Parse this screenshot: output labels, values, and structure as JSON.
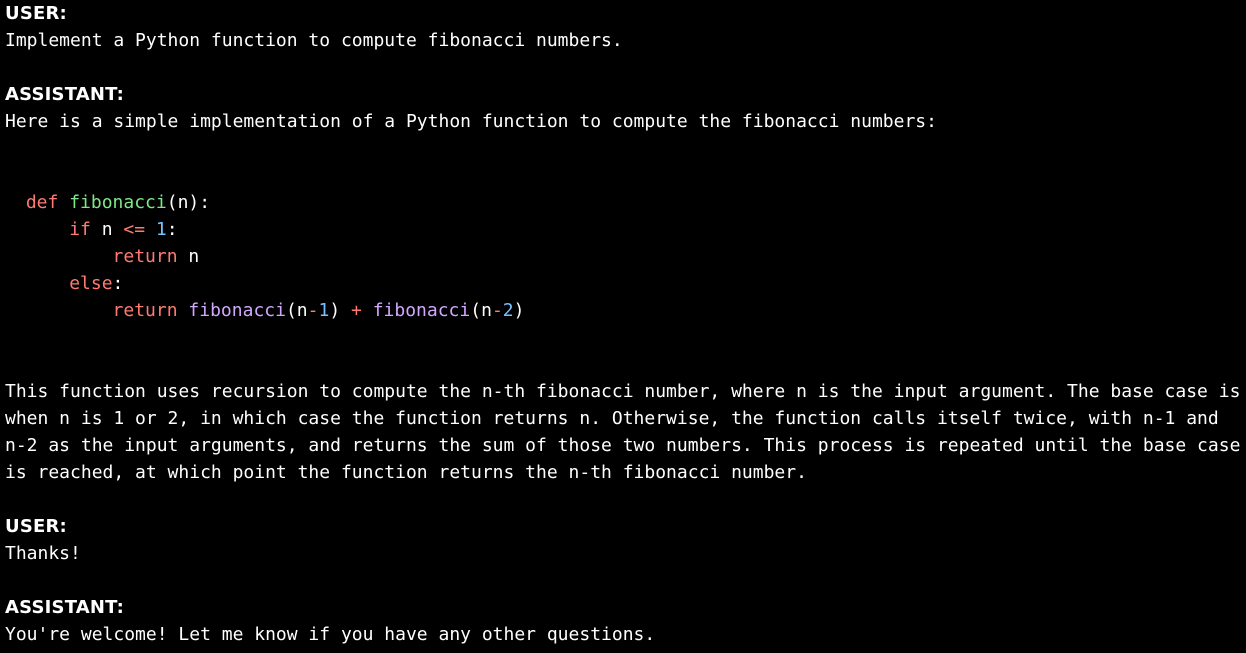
{
  "turns": {
    "t1": {
      "speaker": "USER:",
      "text": "Implement a Python function to compute fibonacci numbers."
    },
    "t2": {
      "speaker": "ASSISTANT:",
      "text": "Here is a simple implementation of a Python function to compute the fibonacci numbers:"
    },
    "t3": {
      "text": "This function uses recursion to compute the n-th fibonacci number, where n is the input argument. The base case is when n is 1 or 2, in which case the function returns n. Otherwise, the function calls itself twice, with n-1 and n-2 as the input arguments, and returns the sum of those two numbers. This process is repeated until the base case is reached, at which point the function returns the n-th fibonacci number."
    },
    "t4": {
      "speaker": "USER:",
      "text": "Thanks!"
    },
    "t5": {
      "speaker": "ASSISTANT:",
      "text": "You're welcome! Let me know if you have any other questions."
    }
  },
  "code": {
    "l1": {
      "kw": "def",
      "fn": "fibonacci",
      "tail": "(n):"
    },
    "l2": {
      "kw": "if",
      "cond_lhs": " n ",
      "op": "<=",
      "sp": " ",
      "num": "1",
      "colon": ":"
    },
    "l3": {
      "kw": "return",
      "tail": " n"
    },
    "l4": {
      "kw": "else",
      "colon": ":"
    },
    "l5": {
      "kw": "return",
      "sp": " ",
      "call": "fibonacci",
      "open": "(n",
      "minus": "-",
      "n1": "1",
      "close": ")",
      "plus": " + ",
      "n2": "2"
    }
  }
}
